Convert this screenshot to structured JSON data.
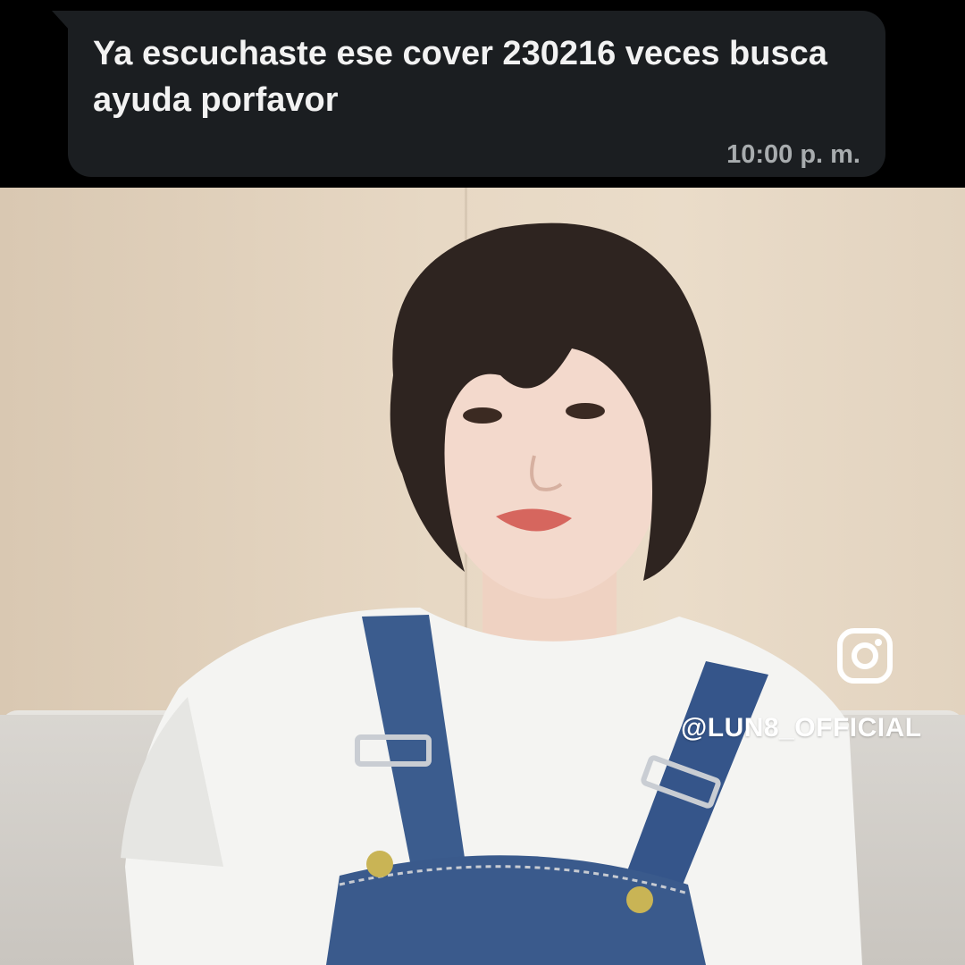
{
  "message": {
    "text": "Ya escuchaste ese cover 230216 veces busca ayuda porfavor",
    "time": "10:00 p. m."
  },
  "video": {
    "watermark_icon": "instagram-icon",
    "watermark_handle": "@LUN8_OFFICIAL"
  },
  "colors": {
    "bubble_bg": "#1b1e21",
    "bubble_text": "#f2f2f2",
    "time_text": "#a8acae",
    "denim": "#3a5a8c",
    "wall": "#e7d8c4"
  }
}
